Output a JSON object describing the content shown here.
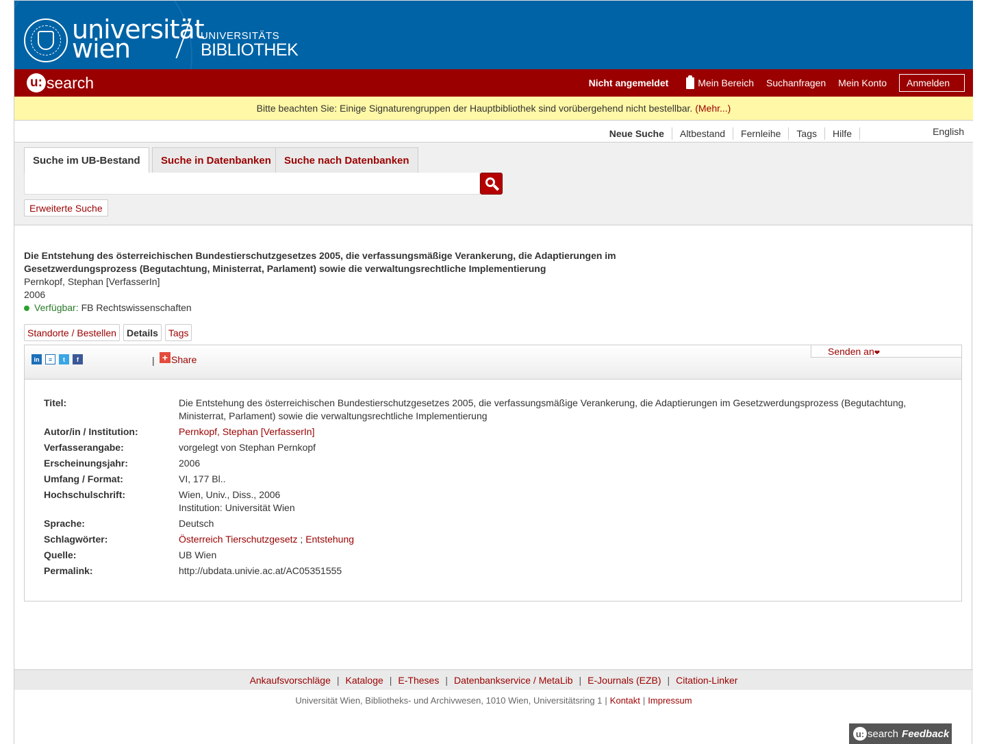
{
  "header": {
    "brand_line1": "universität",
    "brand_line2": "wien",
    "library_line1": "UNIVERSITÄTS",
    "library_line2": "BIBLIOTHEK",
    "app_name": "search",
    "app_prefix": "u:",
    "login_status": "Nicht angemeldet",
    "nav": [
      "Mein Bereich",
      "Suchanfragen",
      "Mein Konto"
    ],
    "login_button": "Anmelden",
    "clipboard_icon": "clipboard-icon",
    "brand_color": "#0063a6",
    "accent_color": "#9a0000"
  },
  "notice": {
    "text": "Bitte beachten Sie: Einige Signaturengruppen der Hauptbibliothek sind vorübergehend nicht bestellbar.",
    "link_open": "(",
    "link": "Mehr...",
    "link_close": ")"
  },
  "subnav": {
    "links": [
      "Neue Suche",
      "Altbestand",
      "Fernleihe",
      "Tags",
      "Hilfe"
    ],
    "active": "Neue Suche",
    "language": "English"
  },
  "search": {
    "tabs": [
      "Suche im UB-Bestand",
      "Suche in Datenbanken",
      "Suche nach Datenbanken"
    ],
    "input_value": "",
    "advanced": "Erweiterte Suche",
    "search_icon": "magnifier-icon"
  },
  "record": {
    "title": "Die Entstehung des österreichischen Bundestierschutzgesetzes 2005, die verfassungsmäßige Verankerung, die Adaptierungen im Gesetzwerdungsprozess (Begutachtung, Ministerrat, Parlament) sowie die verwaltungsrechtliche Implementierung",
    "author": "Pernkopf, Stephan [VerfasserIn]",
    "year": "2006",
    "availability_label": "Verfügbar:",
    "availability_location": "FB Rechtswissenschaften",
    "tabs": [
      "Standorte / Bestellen",
      "Details",
      "Tags"
    ]
  },
  "toolbar": {
    "social_icons": [
      "linkedin-icon",
      "list-icon",
      "twitter-icon",
      "facebook-icon"
    ],
    "share": "Share",
    "send_to": "Senden an"
  },
  "details": [
    {
      "key": "Titel:",
      "value": "Die Entstehung des österreichischen Bundestierschutzgesetzes 2005, die verfassungsmäßige Verankerung, die Adaptierungen im Gesetzwerdungsprozess (Begutachtung, Ministerrat, Parlament) sowie die verwaltungsrechtliche Implementierung"
    },
    {
      "key": "Autor/in / Institution:",
      "value": "Pernkopf, Stephan [VerfasserIn]"
    },
    {
      "key": "Verfasserangabe:",
      "value": "vorgelegt von Stephan Pernkopf"
    },
    {
      "key": "Erscheinungsjahr:",
      "value": "2006"
    },
    {
      "key": "Umfang / Format:",
      "value": "VI, 177 Bl.."
    },
    {
      "key": "Hochschulschrift:",
      "value": "Wien, Univ., Diss., 2006",
      "value2": "Institution: Universität Wien"
    },
    {
      "key": "Sprache:",
      "value": "Deutsch"
    },
    {
      "key": "Schlagwörter:",
      "value": "Österreich Tierschutzgesetz",
      "sep": ";",
      "value2": "Entstehung"
    },
    {
      "key": "Quelle:",
      "value": "UB Wien"
    },
    {
      "key": "Permalink:",
      "value": "http://ubdata.univie.ac.at/AC05351555"
    }
  ],
  "footer": {
    "links": [
      "Ankaufsvorschläge",
      "Kataloge",
      "E-Theses",
      "Datenbankservice / MetaLib",
      "E-Journals (EZB)",
      "Citation-Linker"
    ],
    "separator": "|",
    "address": "Universität Wien, Bibliotheks- und Archivwesen, 1010 Wien, Universitätsring 1",
    "contact": "Kontakt",
    "imprint": "Impressum"
  },
  "feedback": {
    "prefix": "u:",
    "app": "search",
    "label": "Feedback"
  }
}
